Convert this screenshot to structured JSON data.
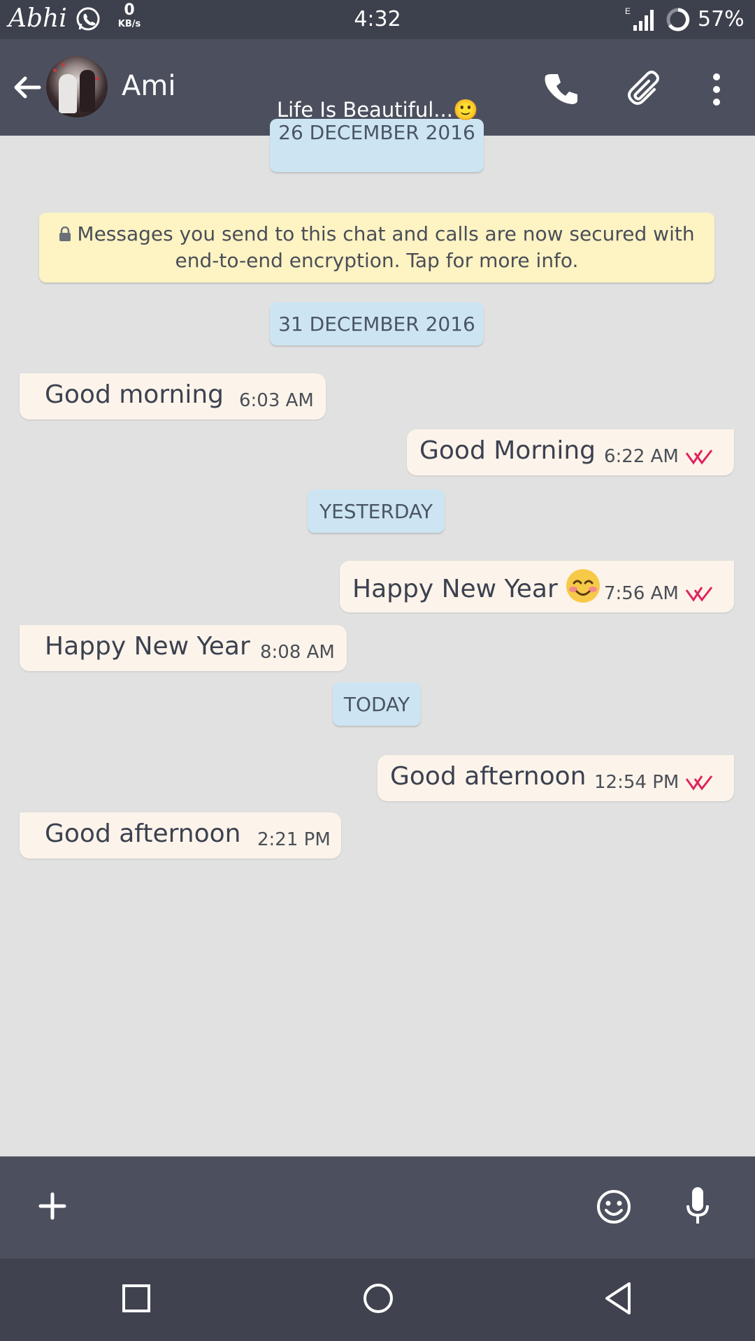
{
  "status_bar": {
    "brand": "Abhi",
    "speed_value": "0",
    "speed_unit": "KB/s",
    "time": "4:32",
    "network": "E",
    "battery": "57%"
  },
  "toolbar": {
    "contact_name": "Ami",
    "status_text": "Life Is Beautiful...",
    "status_emoji": "🙂"
  },
  "chat": {
    "cut_date": "26 DECEMBER 2016",
    "encryption_notice_line1": "Messages you send to this chat and calls are now secured with",
    "encryption_notice_line2": "end-to-end encryption. Tap for more info.",
    "date_1": "31 DECEMBER 2016",
    "date_2": "YESTERDAY",
    "date_3": "TODAY",
    "messages": [
      {
        "dir": "in",
        "text": "Good morning",
        "time": "6:03 AM"
      },
      {
        "dir": "out",
        "text": "Good Morning",
        "time": "6:22 AM",
        "status": "read"
      },
      {
        "dir": "out",
        "text": "Happy New Year",
        "time": "7:56 AM",
        "status": "read",
        "emoji": "blush"
      },
      {
        "dir": "in",
        "text": "Happy New Year",
        "time": "8:08 AM"
      },
      {
        "dir": "out",
        "text": "Good afternoon",
        "time": "12:54 PM",
        "status": "read"
      },
      {
        "dir": "in",
        "text": "Good afternoon",
        "time": "2:21 PM"
      }
    ]
  },
  "colors": {
    "toolbar": "#4c505e",
    "status_bar": "#3d404d",
    "chat_bg": "#e1e1e1",
    "bubble": "#fcf4ea",
    "date_pill": "#cde5f2",
    "notice": "#fdf3c3",
    "read_ticks": "#e0245e"
  }
}
